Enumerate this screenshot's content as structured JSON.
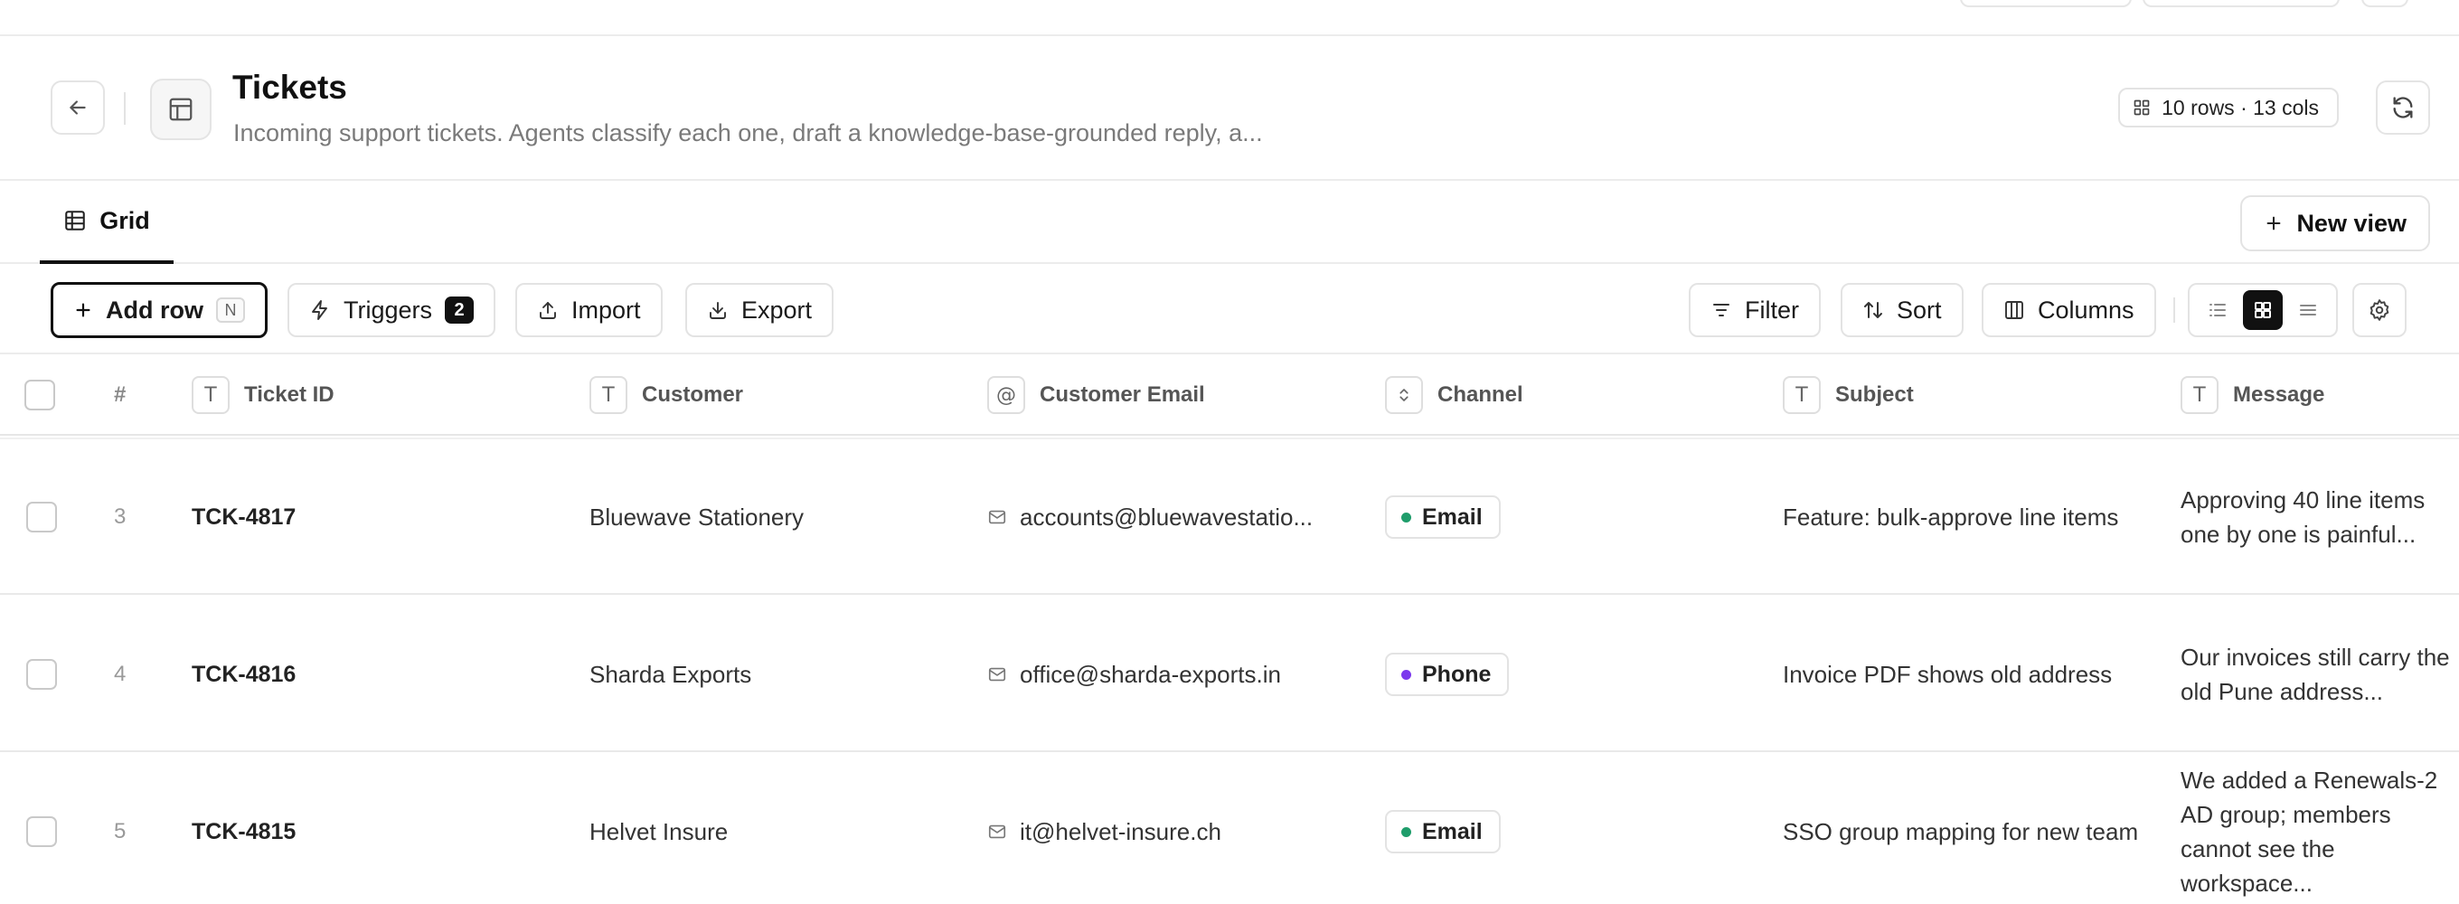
{
  "header": {
    "title": "Tickets",
    "description": "Incoming support tickets. Agents classify each one, draft a knowledge-base-grounded reply, a...",
    "meta": "10 rows · 13 cols"
  },
  "views": {
    "grid_label": "Grid",
    "new_view_label": "New view"
  },
  "toolbar": {
    "add_row_label": "Add row",
    "add_row_shortcut": "N",
    "triggers_label": "Triggers",
    "triggers_count": "2",
    "import_label": "Import",
    "export_label": "Export",
    "filter_label": "Filter",
    "sort_label": "Sort",
    "columns_label": "Columns"
  },
  "table": {
    "hash_label": "#",
    "columns": [
      {
        "label": "Ticket ID",
        "type_glyph": "T"
      },
      {
        "label": "Customer",
        "type_glyph": "T"
      },
      {
        "label": "Customer Email",
        "type_glyph": "@"
      },
      {
        "label": "Channel",
        "type_glyph": "select"
      },
      {
        "label": "Subject",
        "type_glyph": "T"
      },
      {
        "label": "Message",
        "type_glyph": "T"
      }
    ],
    "rows": [
      {
        "num": "3",
        "ticket_id": "TCK-4817",
        "customer": "Bluewave Stationery",
        "email": "accounts@bluewavestatio...",
        "channel": "Email",
        "channel_color": "#1f9d6b",
        "subject": "Feature: bulk-approve line items",
        "message": "Approving 40 line items one by one is painful..."
      },
      {
        "num": "4",
        "ticket_id": "TCK-4816",
        "customer": "Sharda Exports",
        "email": "office@sharda-exports.in",
        "channel": "Phone",
        "channel_color": "#7c3aed",
        "subject": "Invoice PDF shows old address",
        "message": "Our invoices still carry the old Pune address..."
      },
      {
        "num": "5",
        "ticket_id": "TCK-4815",
        "customer": "Helvet Insure",
        "email": "it@helvet-insure.ch",
        "channel": "Email",
        "channel_color": "#1f9d6b",
        "subject": "SSO group mapping for new team",
        "message": "We added a Renewals-2 AD group; members cannot see the workspace..."
      }
    ]
  }
}
